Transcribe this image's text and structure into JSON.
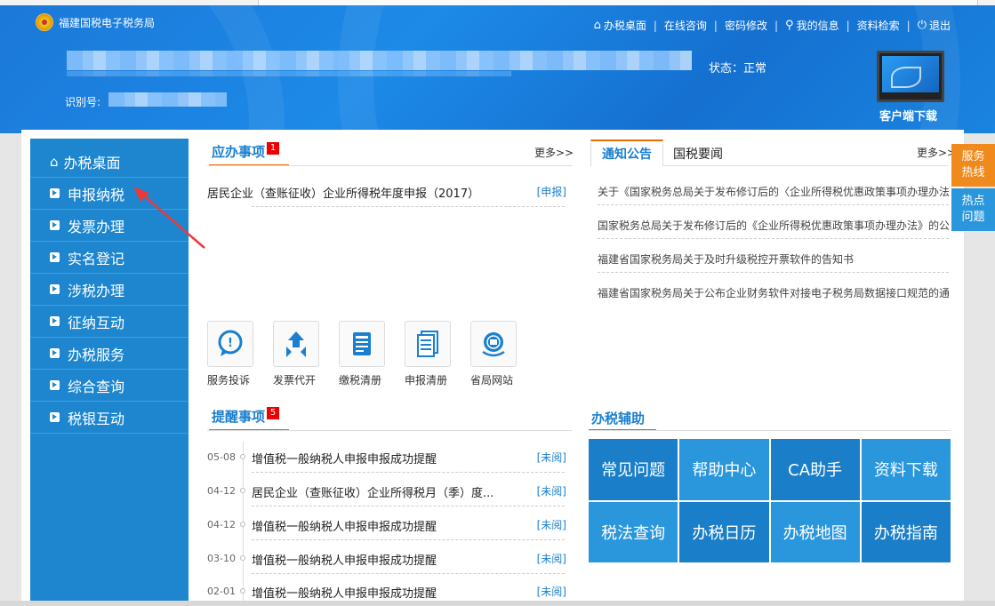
{
  "header": {
    "site_title": "福建国税电子税务局",
    "status": "状态：正常",
    "id_label": "识别号:",
    "client_download": "客户端下载",
    "nav": [
      {
        "label": "办税桌面",
        "icon": "home-icon"
      },
      {
        "label": "在线咨询"
      },
      {
        "label": "密码修改"
      },
      {
        "label": "我的信息",
        "icon": "user-icon"
      },
      {
        "label": "资料检索"
      },
      {
        "label": "退出",
        "icon": "power-icon"
      }
    ],
    "separator": "|"
  },
  "sidebar": {
    "items": [
      {
        "label": "办税桌面",
        "icon": "home-icon"
      },
      {
        "label": "申报纳税",
        "icon": "play-square-icon"
      },
      {
        "label": "发票办理",
        "icon": "play-square-icon"
      },
      {
        "label": "实名登记",
        "icon": "play-square-icon"
      },
      {
        "label": "涉税办理",
        "icon": "play-square-icon"
      },
      {
        "label": "征纳互动",
        "icon": "play-square-icon"
      },
      {
        "label": "办税服务",
        "icon": "play-square-icon"
      },
      {
        "label": "综合查询",
        "icon": "play-square-icon"
      },
      {
        "label": "税银互动",
        "icon": "play-square-icon"
      }
    ]
  },
  "todo": {
    "title": "应办事项",
    "count": "1",
    "more": "更多>>",
    "items": [
      {
        "text": "居民企业（查账征收）企业所得税年度申报（2017）",
        "action": "[申报]"
      }
    ]
  },
  "tools": [
    {
      "label": "服务投诉",
      "icon": "complaint-icon"
    },
    {
      "label": "发票代开",
      "icon": "invoice-issue-icon"
    },
    {
      "label": "缴税清册",
      "icon": "tax-payment-list-icon"
    },
    {
      "label": "申报清册",
      "icon": "declaration-list-icon"
    },
    {
      "label": "省局网站",
      "icon": "bureau-emblem-icon"
    }
  ],
  "notices": {
    "tab_active": "通知公告",
    "tab_other": "国税要闻",
    "more": "更多>>",
    "items": [
      "关于《国家税务总局关于发布修订后的〈企业所得税优惠政策事项办理办法〉的公告》",
      "国家税务总局关于发布修订后的《企业所得税优惠政策事项办理办法》的公告",
      "福建省国家税务局关于及时升级税控开票软件的告知书",
      "福建省国家税务局关于公布企业财务软件对接电子税务局数据接口规范的通知"
    ]
  },
  "reminders": {
    "title": "提醒事项",
    "count": "5",
    "items": [
      {
        "date": "05-08",
        "text": "增值税一般纳税人申报申报成功提醒",
        "status": "[未阅]"
      },
      {
        "date": "04-12",
        "text": "居民企业（查账征收）企业所得税月（季）度...",
        "status": "[未阅]"
      },
      {
        "date": "04-12",
        "text": "增值税一般纳税人申报申报成功提醒",
        "status": "[未阅]"
      },
      {
        "date": "03-10",
        "text": "增值税一般纳税人申报申报成功提醒",
        "status": "[未阅]"
      },
      {
        "date": "02-01",
        "text": "增值税一般纳税人申报申报成功提醒",
        "status": "[未阅]"
      }
    ]
  },
  "assist": {
    "title": "办税辅助",
    "cells": [
      "常见问题",
      "帮助中心",
      "CA助手",
      "资料下载",
      "税法查询",
      "办税日历",
      "办税地图",
      "办税指南"
    ]
  },
  "float": {
    "hotline": "服务热线",
    "faq": "热点问题"
  },
  "colors": {
    "header_blue": "#1b78d8",
    "sidebar_blue": "#1d86cf",
    "accent_orange": "#e36c09",
    "badge_red": "#ee0000"
  }
}
